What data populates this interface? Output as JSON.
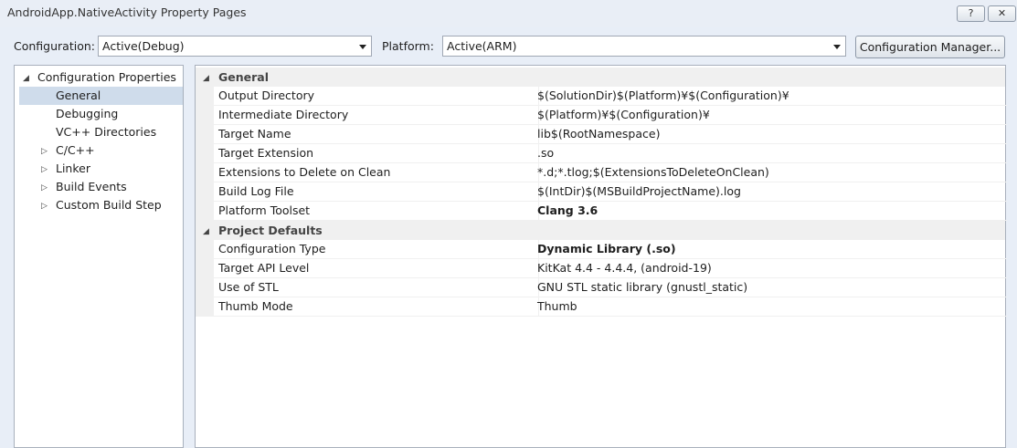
{
  "window": {
    "title": "AndroidApp.NativeActivity Property Pages",
    "help_glyph": "?",
    "close_glyph": "✕"
  },
  "toolbar": {
    "configuration_label": "Configuration:",
    "configuration_value": "Active(Debug)",
    "platform_label": "Platform:",
    "platform_value": "Active(ARM)",
    "config_manager_label": "Configuration Manager..."
  },
  "tree": {
    "root": "Configuration Properties",
    "items": [
      {
        "label": "General",
        "selected": true,
        "expandable": false
      },
      {
        "label": "Debugging",
        "expandable": false
      },
      {
        "label": "VC++ Directories",
        "expandable": false
      },
      {
        "label": "C/C++",
        "expandable": true
      },
      {
        "label": "Linker",
        "expandable": true
      },
      {
        "label": "Build Events",
        "expandable": true
      },
      {
        "label": "Custom Build Step",
        "expandable": true
      }
    ]
  },
  "grid": {
    "categories": [
      {
        "name": "General",
        "properties": [
          {
            "name": "Output Directory",
            "value": "$(SolutionDir)$(Platform)¥$(Configuration)¥"
          },
          {
            "name": "Intermediate Directory",
            "value": "$(Platform)¥$(Configuration)¥"
          },
          {
            "name": "Target Name",
            "value": "lib$(RootNamespace)"
          },
          {
            "name": "Target Extension",
            "value": ".so"
          },
          {
            "name": "Extensions to Delete on Clean",
            "value": "*.d;*.tlog;$(ExtensionsToDeleteOnClean)"
          },
          {
            "name": "Build Log File",
            "value": "$(IntDir)$(MSBuildProjectName).log"
          },
          {
            "name": "Platform Toolset",
            "value": "Clang 3.6",
            "bold": true
          }
        ]
      },
      {
        "name": "Project Defaults",
        "properties": [
          {
            "name": "Configuration Type",
            "value": "Dynamic Library (.so)",
            "bold": true
          },
          {
            "name": "Target API Level",
            "value": "KitKat 4.4 - 4.4.4, (android-19)"
          },
          {
            "name": "Use of STL",
            "value": "GNU STL static library (gnustl_static)"
          },
          {
            "name": "Thumb Mode",
            "value": "Thumb"
          }
        ]
      }
    ]
  }
}
